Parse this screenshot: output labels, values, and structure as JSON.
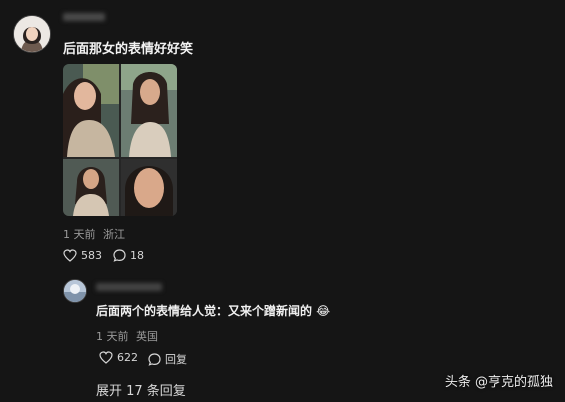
{
  "comment": {
    "text": "后面那女的表情好好笑",
    "time": "1 天前",
    "location": "浙江",
    "likes": "583",
    "replies": "18"
  },
  "reply": {
    "text": "后面两个的表情给人觉：又来个蹭新闻的 😂",
    "time": "1 天前",
    "location": "英国",
    "likes": "622",
    "reply_label": "回复"
  },
  "expand_label": "展开 17 条回复",
  "watermark": "头条 @亨克的孤独",
  "icons": {
    "like": "heart-icon",
    "reply": "comment-bubble-icon"
  }
}
